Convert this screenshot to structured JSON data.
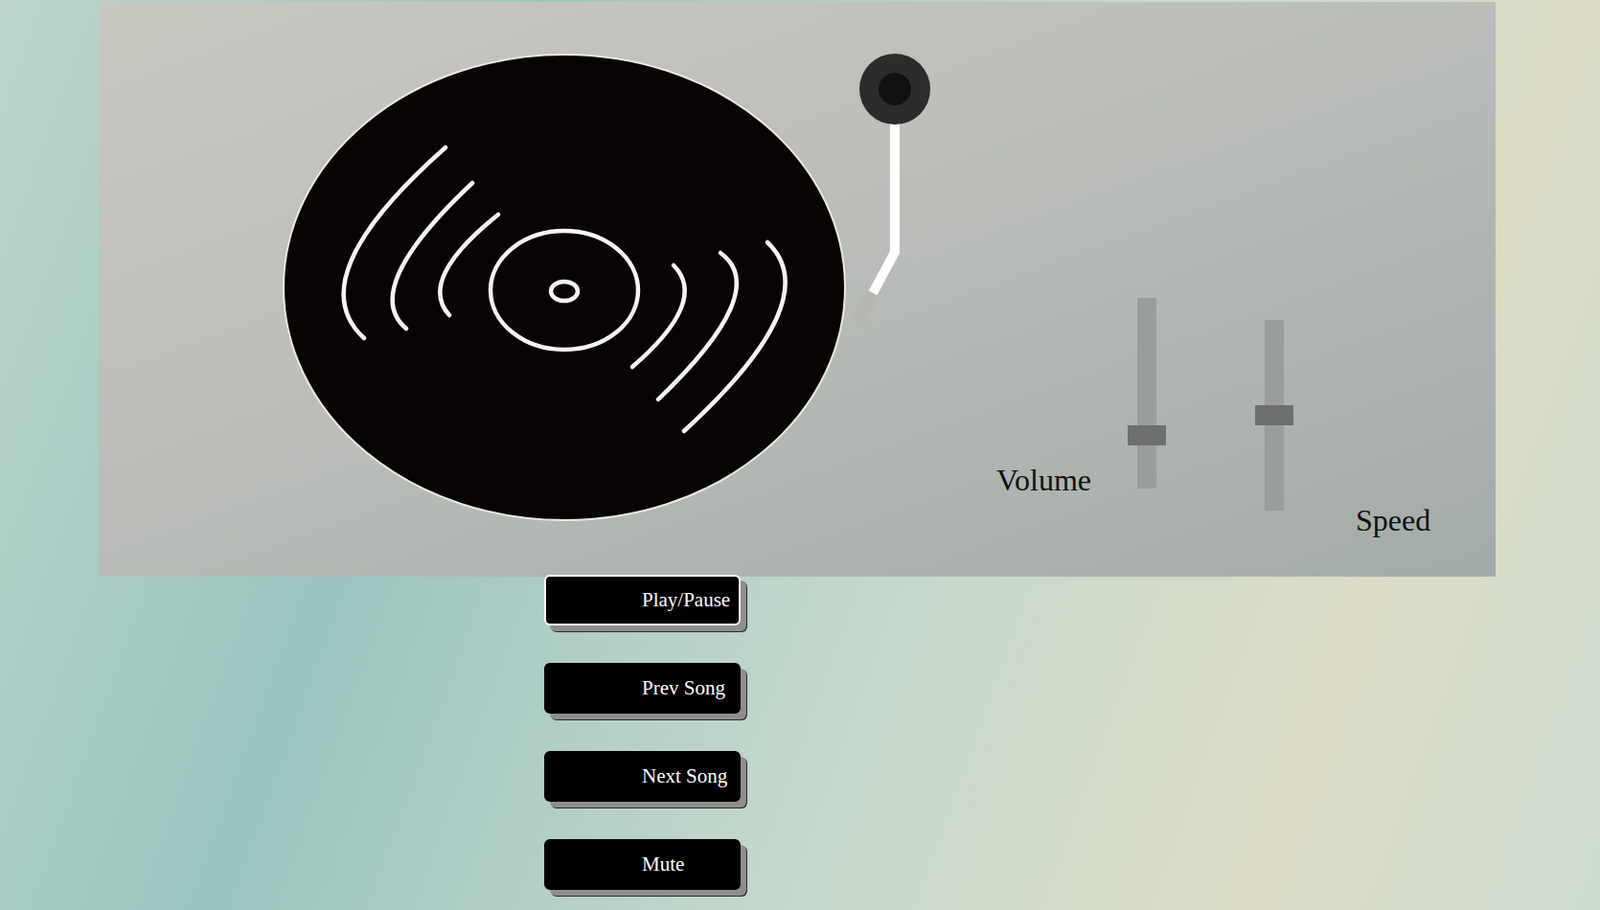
{
  "sliders": [
    {
      "label": "Volume",
      "level": 0.28
    },
    {
      "label": "Speed",
      "level": 0.5
    }
  ],
  "buttons": [
    {
      "label": "Play/Pause",
      "focused": true
    },
    {
      "label": "Prev Song",
      "focused": false
    },
    {
      "label": "Next Song",
      "focused": false
    },
    {
      "label": "Mute",
      "focused": false
    }
  ]
}
